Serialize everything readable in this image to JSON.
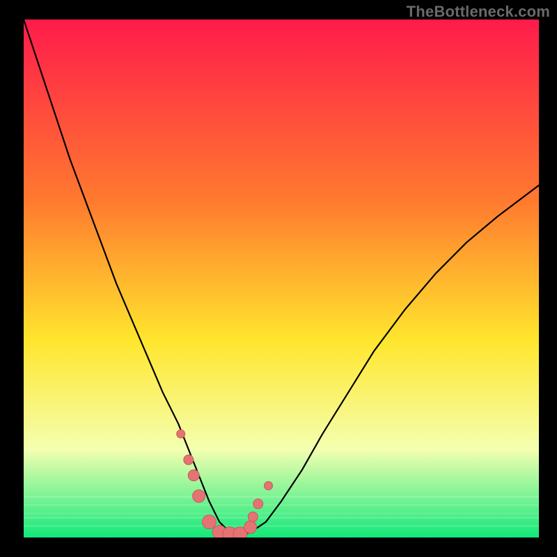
{
  "watermark": "TheBottleneck.com",
  "colors": {
    "bg": "#000000",
    "grad_top": "#ff1b4b",
    "grad_mid1": "#ff7a2f",
    "grad_mid2": "#ffe62d",
    "grad_mid3": "#f4ffb0",
    "grad_bot": "#12e87a",
    "curve": "#000000",
    "marker_fill": "#e57373",
    "marker_stroke": "#c85a5a"
  },
  "chart_data": {
    "type": "line",
    "title": "",
    "xlabel": "",
    "ylabel": "",
    "xlim": [
      0,
      100
    ],
    "ylim": [
      0,
      100
    ],
    "description": "Bottleneck percentage curve with minimum valley near x≈38 and steep rise either side. No axes, no grid, no tick labels.",
    "series": [
      {
        "name": "bottleneck-curve",
        "x": [
          0,
          3,
          6,
          9,
          12,
          15,
          18,
          21,
          24,
          27,
          30,
          32,
          34,
          36,
          38,
          40,
          42,
          44,
          47,
          50,
          54,
          58,
          63,
          68,
          74,
          80,
          86,
          92,
          100
        ],
        "values": [
          100,
          91,
          82,
          73,
          65,
          57,
          49,
          42,
          35,
          28,
          22,
          17,
          12,
          7,
          3,
          1,
          0.5,
          1,
          3,
          7,
          13,
          20,
          28,
          36,
          44,
          51,
          57,
          62,
          68
        ]
      }
    ],
    "markers": {
      "name": "highlight-dots",
      "x": [
        30.5,
        32,
        33,
        34,
        36,
        38,
        40,
        42,
        44,
        44.5,
        45.5,
        47.5
      ],
      "values": [
        20,
        15,
        12,
        8,
        3,
        1,
        0.7,
        0.7,
        2,
        4,
        6.5,
        10
      ],
      "sizes": [
        6,
        7,
        8,
        9,
        10,
        10,
        10,
        10,
        9,
        7,
        7,
        6
      ]
    }
  }
}
